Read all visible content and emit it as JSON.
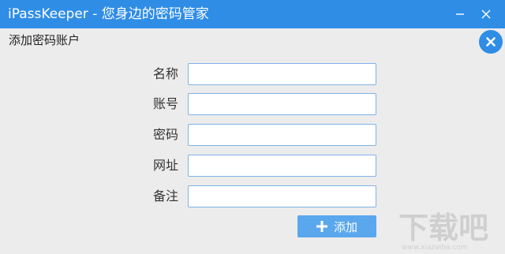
{
  "window": {
    "title": "iPassKeeper  - 您身边的密码管家"
  },
  "dialog": {
    "title": "添加密码账户"
  },
  "form": {
    "fields": [
      {
        "label": "名称",
        "value": "",
        "placeholder": ""
      },
      {
        "label": "账号",
        "value": "",
        "placeholder": ""
      },
      {
        "label": "密码",
        "value": "",
        "placeholder": ""
      },
      {
        "label": "网址",
        "value": "",
        "placeholder": ""
      },
      {
        "label": "备注",
        "value": "",
        "placeholder": ""
      }
    ],
    "add_label": "添加"
  },
  "watermark": {
    "text": "下载吧",
    "url": "www.xiazaiba.com"
  },
  "colors": {
    "titlebar": "#2f8de6",
    "button": "#5aa7ee",
    "input_border": "#7fb2e6",
    "background": "#ececec"
  },
  "icons": [
    "minimize-icon",
    "close-icon",
    "close-circle-icon",
    "plus-icon"
  ]
}
